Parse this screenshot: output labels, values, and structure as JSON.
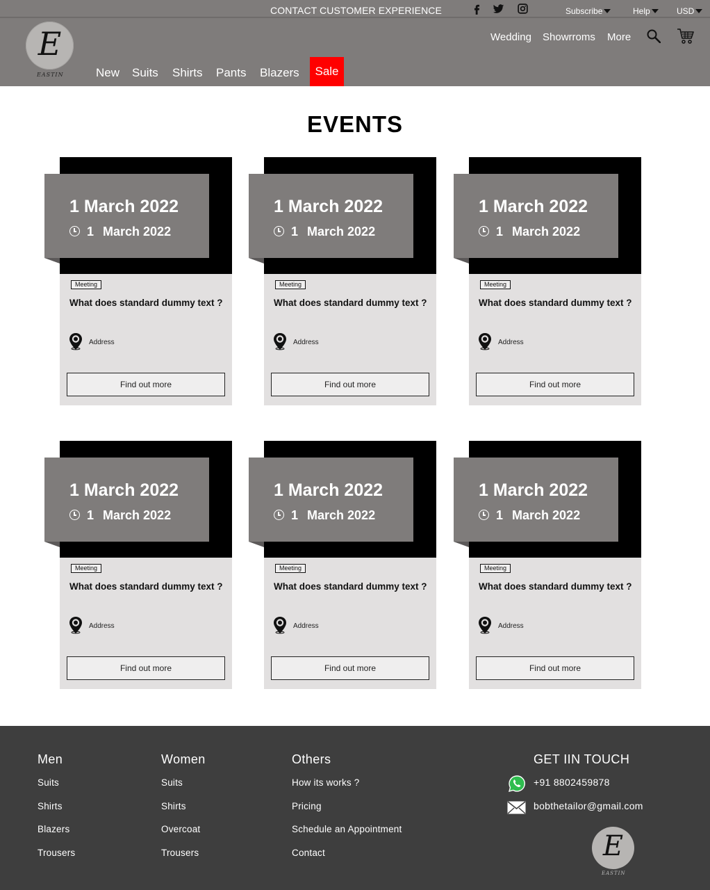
{
  "header": {
    "contact": "CONTACT CUSTOMER EXPERIENCE",
    "social_icons": [
      "facebook-icon",
      "twitter-icon",
      "instagram-icon"
    ],
    "subscribe": "Subscribe",
    "help": "Help",
    "currency": "USD",
    "logo_glyph": "E",
    "logo_word": "EASTIN",
    "categories": [
      "New",
      "Suits",
      "Shirts",
      "Pants",
      "Blazers"
    ],
    "sale": "Sale",
    "right_links": [
      "Wedding",
      "Showrroms",
      "More"
    ],
    "colors": {
      "bar": "#7f7c7b",
      "sale": "#ff0000"
    }
  },
  "events": {
    "title": "EVENTS",
    "cards": [
      {
        "date": "1 March 2022",
        "day": "1",
        "month_year": "March 2022",
        "tag": "Meeting",
        "title": "What does standard dummy text ?",
        "address": "Address",
        "button": "Find out more"
      },
      {
        "date": "1 March 2022",
        "day": "1",
        "month_year": "March 2022",
        "tag": "Meeting",
        "title": "What does standard dummy text ?",
        "address": "Address",
        "button": "Find out more"
      },
      {
        "date": "1 March 2022",
        "day": "1",
        "month_year": "March 2022",
        "tag": "Meeting",
        "title": "What does standard dummy text ?",
        "address": "Address",
        "button": "Find out more"
      },
      {
        "date": "1 March 2022",
        "day": "1",
        "month_year": "March 2022",
        "tag": "Meeting",
        "title": "What does standard dummy text ?",
        "address": "Address",
        "button": "Find out more"
      },
      {
        "date": "1 March 2022",
        "day": "1",
        "month_year": "March 2022",
        "tag": "Meeting",
        "title": "What does standard dummy text ?",
        "address": "Address",
        "button": "Find out more"
      },
      {
        "date": "1 March 2022",
        "day": "1",
        "month_year": "March 2022",
        "tag": "Meeting",
        "title": "What does standard dummy text ?",
        "address": "Address",
        "button": "Find out more"
      }
    ]
  },
  "footer": {
    "men": {
      "heading": "Men",
      "links": [
        "Suits",
        "Shirts",
        "Blazers",
        "Trousers"
      ]
    },
    "women": {
      "heading": "Women",
      "links": [
        "Suits",
        "Shirts",
        "Overcoat",
        "Trousers"
      ]
    },
    "others": {
      "heading": "Others",
      "links": [
        "How its works ?",
        "Pricing",
        "Schedule an Appointment",
        "Contact"
      ]
    },
    "contact": {
      "heading": "GET IIN TOUCH",
      "phone": "+91 8802459878",
      "email": "bobthetailor@gmail.com"
    },
    "logo_glyph": "E",
    "logo_word": "EASTIN",
    "colors": {
      "background": "#3e3e3e"
    }
  }
}
